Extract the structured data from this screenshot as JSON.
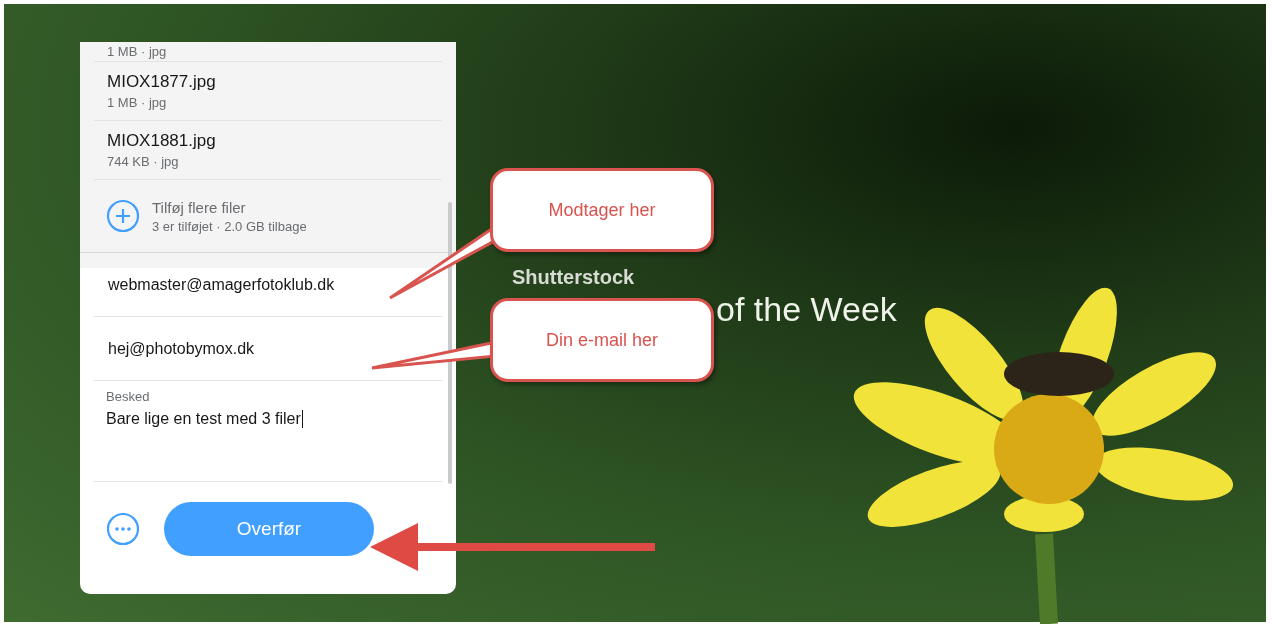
{
  "files": [
    {
      "meta": "1 MB · jpg"
    },
    {
      "name": "MIOX1877.jpg",
      "meta": "1 MB · jpg"
    },
    {
      "name": "MIOX1881.jpg",
      "meta": "744 KB · jpg"
    }
  ],
  "add_files": {
    "label": "Tilføj flere filer",
    "info": "3 er tilføjet · 2.0 GB tilbage"
  },
  "recipient_email": "webmaster@amagerfotoklub.dk",
  "sender_email": "hej@photobymox.dk",
  "message": {
    "label": "Besked",
    "value": "Bare lige en test med 3 filer"
  },
  "transfer_button": "Overfør",
  "background": {
    "logo": "Shutterstock",
    "headline": "of the Week"
  },
  "callouts": [
    {
      "text": "Modtager her"
    },
    {
      "text": "Din e-mail her"
    }
  ]
}
